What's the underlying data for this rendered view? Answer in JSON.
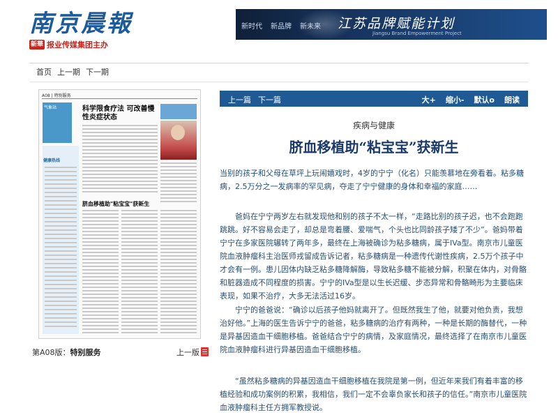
{
  "masthead": {
    "logo": "南京晨報",
    "publisher_mark": "新華",
    "publisher": "报业传媒集团主办",
    "top_links": "",
    "ad": {
      "tags": [
        "新时代",
        "新品牌",
        "新未来"
      ],
      "title": "江苏品牌赋能计划",
      "subtitle": "Jiangsu Brand Empowerment Project"
    }
  },
  "top_nav": [
    "首页",
    "上一期",
    "下一期"
  ],
  "thumbnail": {
    "header": "A08 | 特别服务",
    "weather_label": "气象站",
    "sidebar_title": "健康热线",
    "headline1": "科学限食疗法 可改善慢性炎症状态",
    "headline2": "脐血移植助\"粘宝宝\"获新生",
    "caption_prefix": "第A08版：",
    "caption_name": "特别服务",
    "prev_label": "上一版"
  },
  "toolbar": {
    "prev": "上一篇",
    "next": "下一篇",
    "zoom_in": "大+",
    "zoom_out": "缩小-",
    "default": "默认o",
    "read": "朗读"
  },
  "article": {
    "kicker": "疾病与健康",
    "title": "脐血移植助“粘宝宝”获新生",
    "lead": "当别的孩子和父母在草坪上玩闹嬉戏时，4岁的宁宁（化名）只能羡慕地在旁看着。粘多糖病，2.5万分之一发病率的罕见病，夺走了宁宁健康的身体和幸福的家庭……",
    "paragraphs": [
      "爸妈在宁宁两岁左右就发现他和别的孩子不太一样，“走路比别的孩子迟，也不会跑跑跳跳。好不容易会走了，却总是弯着腰、爱喘气，个头也比同龄孩子矮了不少”。爸妈带着宁宁在多家医院辗转了两年多，最终在上海被确诊为粘多糖病，属于IVa型。南京市儿童医院血液肿瘤科主治医师戎留成告诉记者，粘多糖病是一种遗传代谢性疾病，2.5万个孩子中才会有一例。患儿因体内缺乏粘多糖降解酶，导致粘多糖不能被分解，积聚在体内，对骨骼和脏器造成不同程度的损害。宁宁的IVa型是以生长迟缓、步态异常和骨骼畸形为主要临床表现，如果不治疗，大多无法活过16岁。",
      "宁宁的爸爸说：“确诊以后孩子他妈就离开了。但既然我生了他，就要对他负责，我想治好他。”上海的医生告诉宁宁的爸爸，粘多糖病的治疗有两种，一种是长期的酶替代，一种是异基因造血干细胞移植。爸爸结合宁宁的病情，及家庭情况，最终选择了在南京市儿童医院血液肿瘤科进行异基因造血干细胞移植。",
      "“虽然粘多糖病的异基因造血干细胞移植在我院是第一例，但近年来我们有着丰富的移植经验和成功案例的积累，我相信，我们一定不会辜负家长和孩子的信任。”南京市儿童医院血液肿瘤科主任方拥军教授说。"
    ]
  }
}
